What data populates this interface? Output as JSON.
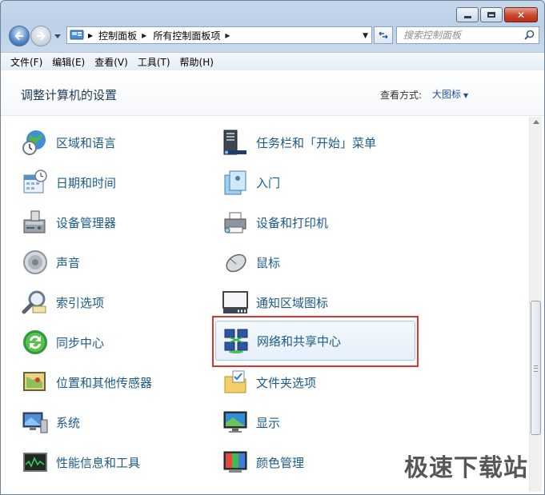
{
  "window": {
    "controls": {
      "minimize": "minimize",
      "maximize": "maximize",
      "close": "close"
    }
  },
  "address": {
    "crumbs": [
      "控制面板",
      "所有控制面板项"
    ]
  },
  "search": {
    "placeholder": "搜索控制面板"
  },
  "menu": [
    "文件(F)",
    "编辑(E)",
    "查看(V)",
    "工具(T)",
    "帮助(H)"
  ],
  "header": {
    "title": "调整计算机的设置",
    "view_by_label": "查看方式:",
    "view_by_value": "大图标"
  },
  "items_left": [
    {
      "label": "区域和语言",
      "icon": "globe-clock-icon"
    },
    {
      "label": "日期和时间",
      "icon": "calendar-clock-icon"
    },
    {
      "label": "设备管理器",
      "icon": "device-manager-icon"
    },
    {
      "label": "声音",
      "icon": "speaker-icon"
    },
    {
      "label": "索引选项",
      "icon": "magnifier-icon"
    },
    {
      "label": "同步中心",
      "icon": "sync-icon"
    },
    {
      "label": "位置和其他传感器",
      "icon": "location-sensor-icon"
    },
    {
      "label": "系统",
      "icon": "system-computer-icon"
    },
    {
      "label": "性能信息和工具",
      "icon": "performance-chart-icon"
    }
  ],
  "items_right": [
    {
      "label": "任务栏和「开始」菜单",
      "icon": "taskbar-icon"
    },
    {
      "label": "入门",
      "icon": "getting-started-icon"
    },
    {
      "label": "设备和打印机",
      "icon": "printer-icon"
    },
    {
      "label": "鼠标",
      "icon": "mouse-icon"
    },
    {
      "label": "通知区域图标",
      "icon": "notification-area-icon"
    },
    {
      "label": "网络和共享中心",
      "icon": "network-icon"
    },
    {
      "label": "文件夹选项",
      "icon": "folder-options-icon"
    },
    {
      "label": "显示",
      "icon": "display-icon"
    },
    {
      "label": "颜色管理",
      "icon": "color-management-icon"
    }
  ],
  "selected_item": "网络和共享中心",
  "watermark": "极速下载站",
  "colors": {
    "link": "#1c5a8c",
    "title": "#1e395b",
    "highlight_border": "#e0332a"
  }
}
